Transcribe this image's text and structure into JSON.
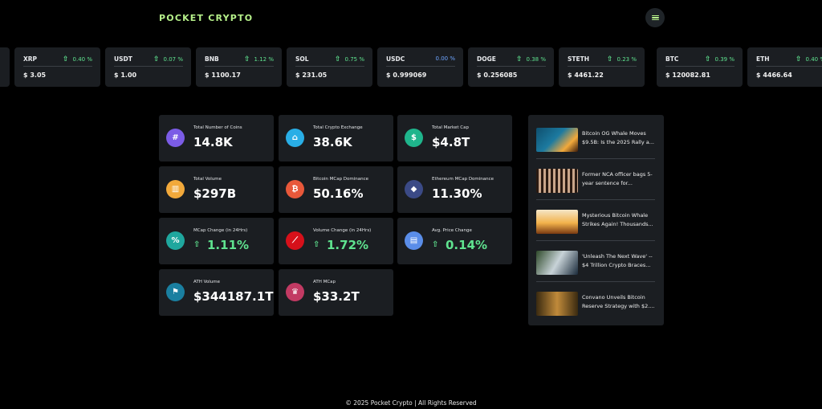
{
  "header": {
    "logo": "POCKET CRYPTO",
    "menu_icon": "hamburger-icon"
  },
  "ticker": [
    {
      "symbol": "XRP",
      "change": "0.40 %",
      "direction": "up",
      "price": "$ 3.05"
    },
    {
      "symbol": "USDT",
      "change": "0.07 %",
      "direction": "up",
      "price": "$ 1.00"
    },
    {
      "symbol": "BNB",
      "change": "1.12 %",
      "direction": "up",
      "price": "$ 1100.17"
    },
    {
      "symbol": "SOL",
      "change": "0.75 %",
      "direction": "up",
      "price": "$ 231.05"
    },
    {
      "symbol": "USDC",
      "change": "0.00 %",
      "direction": "flat",
      "price": "$ 0.999069"
    },
    {
      "symbol": "DOGE",
      "change": "0.38 %",
      "direction": "up",
      "price": "$ 0.256085"
    },
    {
      "symbol": "STETH",
      "change": "0.23 %",
      "direction": "up",
      "price": "$ 4461.22"
    },
    {
      "symbol": "BTC",
      "change": "0.39 %",
      "direction": "up",
      "price": "$ 120082.81"
    },
    {
      "symbol": "ETH",
      "change": "0.40 %",
      "direction": "up",
      "price": "$ 4466.64"
    }
  ],
  "stats": [
    {
      "label": "Total Number of Coins",
      "value": "14.8K",
      "icon": "hash-icon",
      "glyph": "#",
      "color": "#7b5ce6"
    },
    {
      "label": "Total Crypto Exchange",
      "value": "38.6K",
      "icon": "bank-icon",
      "glyph": "⌂",
      "color": "#29aee6"
    },
    {
      "label": "Total Market Cap",
      "value": "$4.8T",
      "icon": "dollar-icon",
      "glyph": "$",
      "color": "#1fb58c"
    },
    {
      "label": "Total Volume",
      "value": "$297B",
      "icon": "bar-chart-icon",
      "glyph": "▥",
      "color": "#f2a93b"
    },
    {
      "label": "Bitcoin MCap Dominance",
      "value": "50.16%",
      "icon": "bitcoin-icon",
      "glyph": "₿",
      "color": "#e8583a"
    },
    {
      "label": "Ethereum MCap Dominance",
      "value": "11.30%",
      "icon": "ethereum-icon",
      "glyph": "◆",
      "color": "#3b4a86"
    },
    {
      "label": "MCap Change (in 24Hrs)",
      "value": "1.11%",
      "icon": "percent-icon",
      "glyph": "%",
      "color": "#1fa79e",
      "trend": "up"
    },
    {
      "label": "Volume Change (in 24Hrs)",
      "value": "1.72%",
      "icon": "line-chart-icon",
      "glyph": "⟋",
      "color": "#d6101a",
      "trend": "up"
    },
    {
      "label": "Avg. Price Change",
      "value": "0.14%",
      "icon": "chart-icon",
      "glyph": "▤",
      "color": "#5a8de8",
      "trend": "up"
    },
    {
      "label": "ATH Volume",
      "value": "$344187.1T",
      "icon": "flag-icon",
      "glyph": "⚑",
      "color": "#1a7fa0"
    },
    {
      "label": "ATH MCap",
      "value": "$33.2T",
      "icon": "trophy-icon",
      "glyph": "♛",
      "color": "#c23a63"
    }
  ],
  "news": [
    {
      "title": "Bitcoin OG Whale Moves $9.5B: Is the 2025 Rally a...",
      "thumb": "whale-image"
    },
    {
      "title": "Former NCA officer bags 5-year sentence for...",
      "thumb": "prison-image"
    },
    {
      "title": "Mysterious Bitcoin Whale Strikes Again! Thousands...",
      "thumb": "bitcoin-whale-image"
    },
    {
      "title": "'Unleash The Next Wave' -- $4 Trillion Crypto Braces...",
      "thumb": "speaker-image"
    },
    {
      "title": "Convano Unveils Bitcoin Reserve Strategy with $2....",
      "thumb": "convano-image"
    }
  ],
  "footer": "© 2025 Pocket Crypto | All Rights Reserved"
}
